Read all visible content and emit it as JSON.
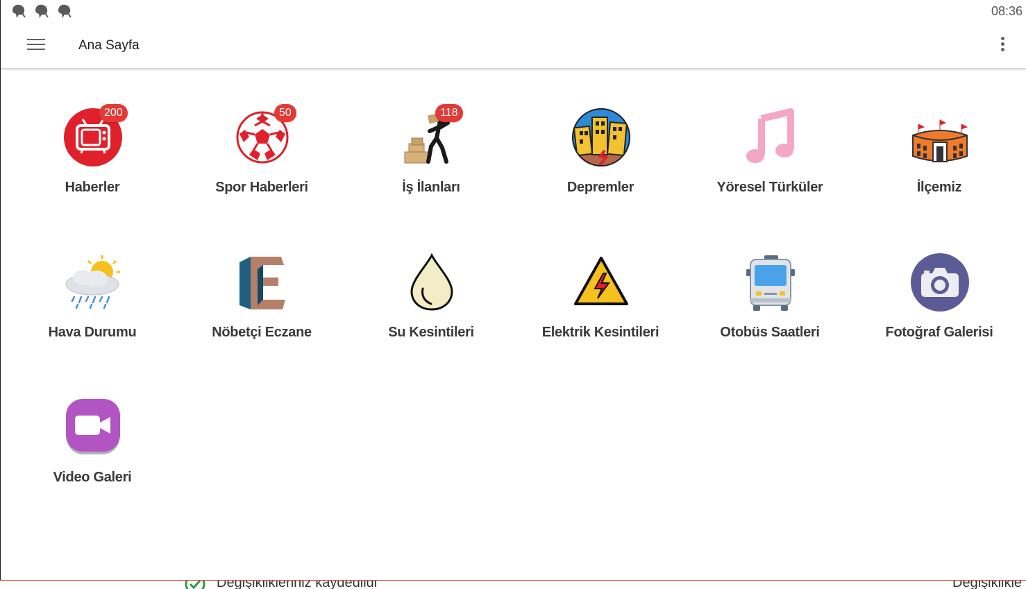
{
  "status_bar": {
    "icons": [
      "notification-icon",
      "notification-icon",
      "notification-icon"
    ],
    "time": "08:36"
  },
  "toolbar": {
    "title": "Ana Sayfa",
    "menu_icon": "hamburger-menu-icon",
    "overflow_icon": "more-vert-icon"
  },
  "tiles": [
    {
      "label": "Haberler",
      "icon": "tv-icon",
      "badge": "200"
    },
    {
      "label": "Spor Haberleri",
      "icon": "soccer-ball-icon",
      "badge": "50"
    },
    {
      "label": "İş İlanları",
      "icon": "worker-carrying-boxes-icon",
      "badge": "118"
    },
    {
      "label": "Depremler",
      "icon": "earthquake-buildings-icon"
    },
    {
      "label": "Yöresel Türküler",
      "icon": "music-note-icon"
    },
    {
      "label": "İlçemiz",
      "icon": "stadium-icon"
    },
    {
      "label": "Hava Durumu",
      "icon": "weather-sun-rain-icon"
    },
    {
      "label": "Nöbetçi Eczane",
      "icon": "letter-e-icon"
    },
    {
      "label": "Su Kesintileri",
      "icon": "water-drop-icon"
    },
    {
      "label": "Elektrik Kesintileri",
      "icon": "high-voltage-warning-icon"
    },
    {
      "label": "Otobüs Saatleri",
      "icon": "bus-icon"
    },
    {
      "label": "Fotoğraf Galerisi",
      "icon": "camera-icon"
    },
    {
      "label": "Video Galeri",
      "icon": "video-camera-icon"
    }
  ],
  "bottom_strip": {
    "left_message": "Değişiklikleriniz kaydedildi",
    "right_message": "Değişiklikle"
  },
  "colors": {
    "badge": "#e53935",
    "label": "#3a3a3a",
    "toolbar_text": "#212121",
    "status_text": "#555555"
  }
}
